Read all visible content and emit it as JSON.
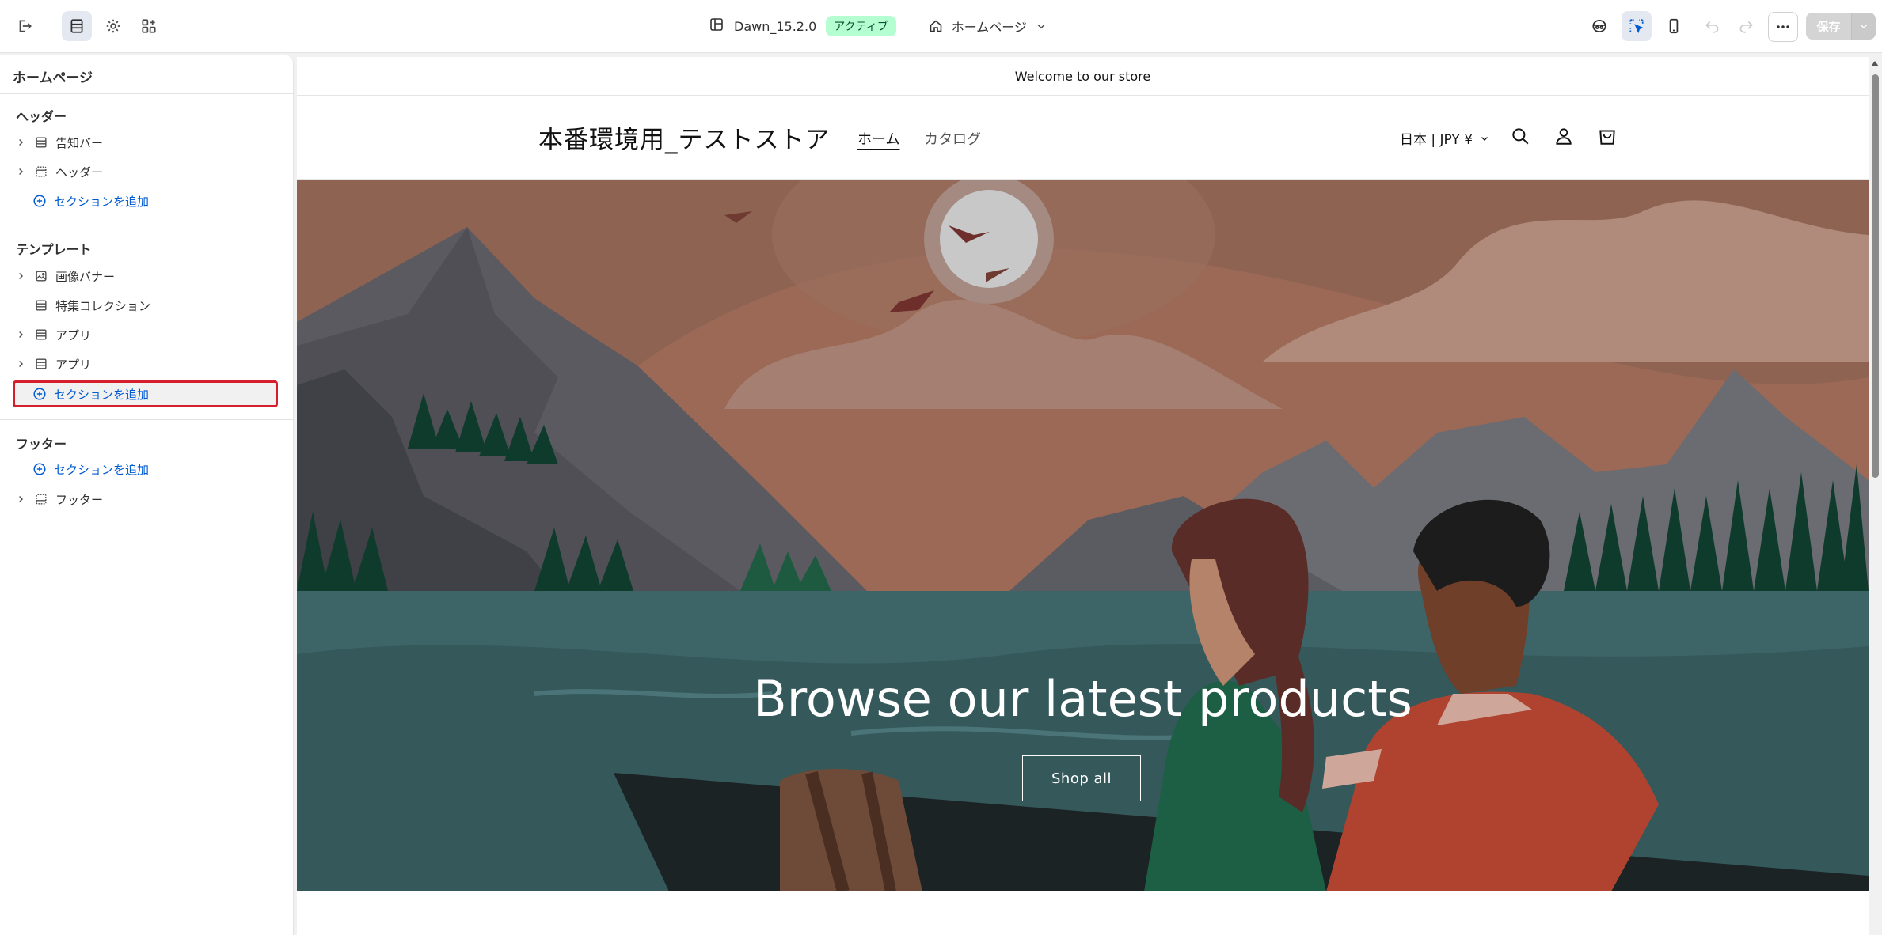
{
  "topbar": {
    "theme_name": "Dawn_15.2.0",
    "status_badge": "アクティブ",
    "current_page": "ホームページ",
    "save_label": "保存",
    "colors": {
      "badge_bg": "#b4fed2",
      "badge_text": "#0c5132",
      "accent": "#005bd3"
    }
  },
  "sidebar": {
    "title": "ホームページ",
    "groups": {
      "header": {
        "label": "ヘッダー",
        "items": [
          "告知バー",
          "ヘッダー"
        ],
        "add_label": "セクションを追加"
      },
      "template": {
        "label": "テンプレート",
        "items": [
          "画像バナー",
          "特集コレクション",
          "アプリ",
          "アプリ"
        ],
        "add_label": "セクションを追加"
      },
      "footer": {
        "label": "フッター",
        "add_label": "セクションを追加",
        "items": [
          "フッター"
        ]
      }
    }
  },
  "preview": {
    "announcement": "Welcome to our store",
    "store_name": "本番環境用_テストストア",
    "nav": [
      "ホーム",
      "カタログ"
    ],
    "currency": "日本 | JPY ¥",
    "hero_heading": "Browse our latest products",
    "hero_button": "Shop all"
  }
}
